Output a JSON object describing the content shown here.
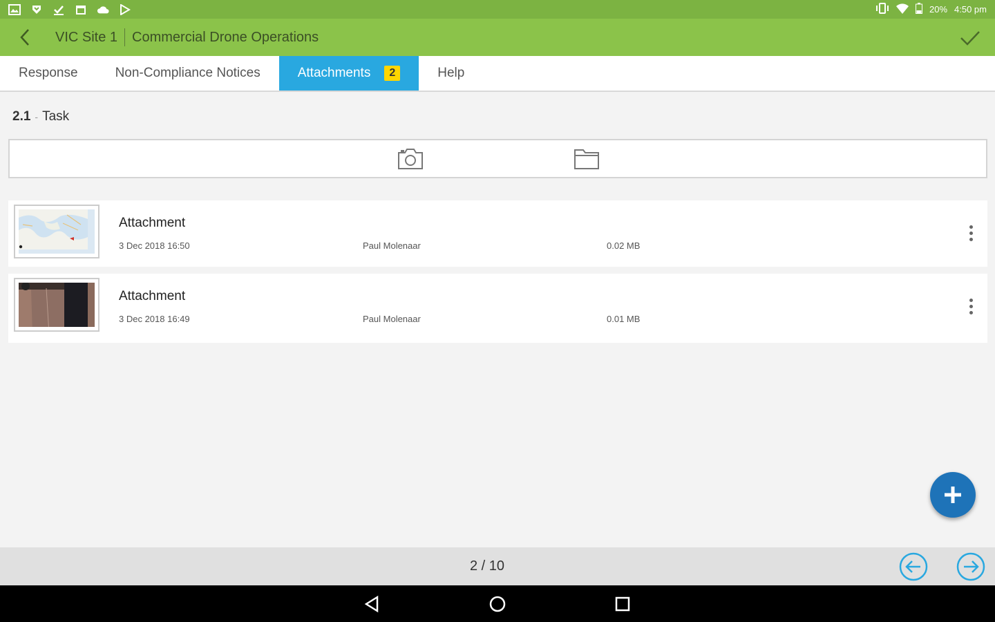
{
  "status_bar": {
    "battery": "20%",
    "time": "4:50 pm",
    "icons": [
      "gallery-icon",
      "download-icon",
      "task-check-icon",
      "calendar-icon",
      "cloud-icon",
      "play-store-icon",
      "vibrate-icon",
      "wifi-icon",
      "battery-icon"
    ]
  },
  "header": {
    "site": "VIC Site 1",
    "title": "Commercial Drone Operations"
  },
  "tabs": [
    {
      "label": "Response"
    },
    {
      "label": "Non-Compliance Notices"
    },
    {
      "label": "Attachments",
      "badge": "2"
    },
    {
      "label": "Help"
    }
  ],
  "section": {
    "number": "2.1",
    "separator": "-",
    "label": "Task"
  },
  "attachments": [
    {
      "title": "Attachment",
      "date": "3 Dec 2018 16:50",
      "author": "Paul Molenaar",
      "size": "0.02 MB",
      "thumbnail": "map-thumbnail"
    },
    {
      "title": "Attachment",
      "date": "3 Dec 2018 16:49",
      "author": "Paul Molenaar",
      "size": "0.01 MB",
      "thumbnail": "photo-thumbnail"
    }
  ],
  "pagination": {
    "text": "2 / 10"
  },
  "colors": {
    "status_bar": "#7cb342",
    "app_bar": "#8bc34a",
    "active_tab": "#29a8e0",
    "badge": "#ffd600",
    "fab": "#1e73b8",
    "nav_arrows": "#29a8e0"
  }
}
